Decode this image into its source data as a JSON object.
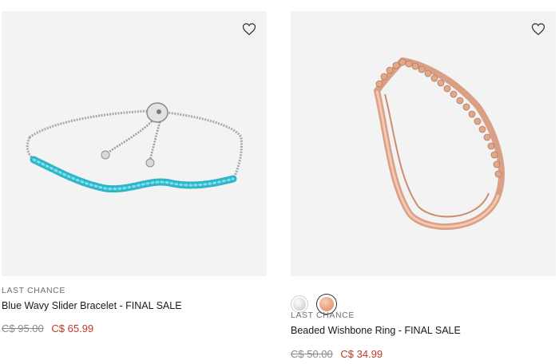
{
  "products": [
    {
      "badge": "LAST CHANCE",
      "name": "Blue Wavy Slider Bracelet - FINAL SALE",
      "old_price": "C$ 95.00",
      "new_price": "C$ 65.99",
      "image": "bracelet-silver-blue-stones",
      "wishlist_icon": "heart-icon"
    },
    {
      "badge": "LAST CHANCE",
      "name": "Beaded Wishbone Ring - FINAL SALE",
      "old_price": "C$ 50.00",
      "new_price": "C$ 34.99",
      "image": "ring-rose-gold-beaded",
      "wishlist_icon": "heart-icon",
      "swatches": [
        {
          "name": "silver",
          "color": "#d9d9d9",
          "selected": false
        },
        {
          "name": "rose-gold",
          "color": "#e5a383",
          "selected": true
        }
      ]
    }
  ],
  "colors": {
    "image_bg": "#f3f3f3",
    "sale_price": "#c0392b",
    "old_price": "#8a8a8a",
    "badge_text": "#6e6e6e"
  }
}
